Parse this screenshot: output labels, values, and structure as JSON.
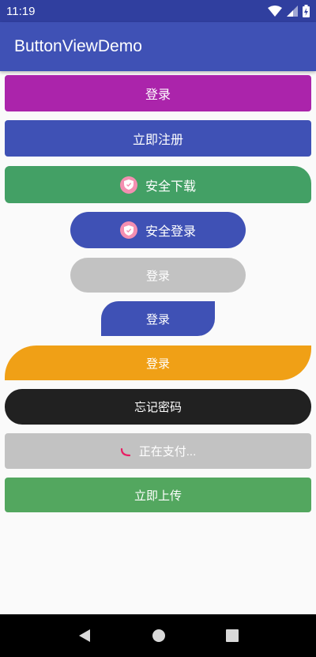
{
  "status_bar": {
    "time": "11:19"
  },
  "app_bar": {
    "title": "ButtonViewDemo"
  },
  "buttons": {
    "login1": "登录",
    "register": "立即注册",
    "safe_download": "安全下载",
    "safe_login": "安全登录",
    "login_disabled": "登录",
    "login_shape": "登录",
    "login_orange": "登录",
    "forgot_password": "忘记密码",
    "paying": "正在支付...",
    "upload": "立即上传"
  },
  "colors": {
    "primary_dark": "#303f9f",
    "primary": "#3f51b5",
    "purple": "#ab24ab",
    "green": "#43a065",
    "gray": "#c2c2c2",
    "orange": "#f0a016",
    "dark": "#212121",
    "green2": "#53a75f",
    "pink": "#f48fb1"
  },
  "icons": {
    "wifi": "wifi-icon",
    "signal": "signal-icon",
    "battery": "battery-charging-icon",
    "shield": "shield-icon",
    "spinner": "spinner-icon",
    "back": "back-icon",
    "home": "home-icon",
    "recents": "recents-icon"
  }
}
